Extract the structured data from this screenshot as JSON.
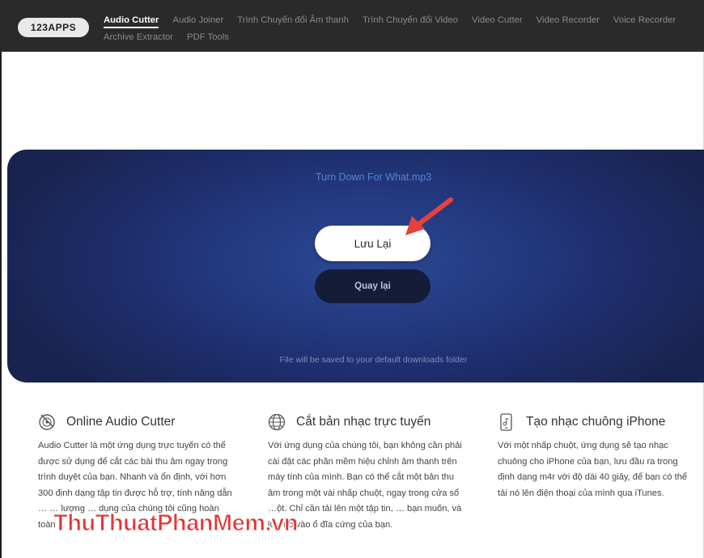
{
  "brand": {
    "logo": "123APPS"
  },
  "nav": {
    "items": [
      {
        "label": "Audio Cutter",
        "active": true
      },
      {
        "label": "Audio Joiner"
      },
      {
        "label": "Trình Chuyển đổi Âm thanh"
      },
      {
        "label": "Trình Chuyển đổi Video"
      },
      {
        "label": "Video Cutter"
      },
      {
        "label": "Video Recorder"
      },
      {
        "label": "Voice Recorder"
      },
      {
        "label": "Archive Extractor"
      },
      {
        "label": "PDF Tools"
      }
    ]
  },
  "editor": {
    "filename": "Turn Down For What.mp3",
    "save_label": "Lưu Lại",
    "back_label": "Quay lại",
    "save_note": "File will be saved to your default downloads folder"
  },
  "features": [
    {
      "icon": "vinyl-scissors-icon",
      "title": "Online Audio Cutter",
      "body": "Audio Cutter là một ứng dụng trực tuyến có thể được sử dụng để cắt các bài thu âm ngay trong trình duyệt của bạn. Nhanh và ổn định, với hơn 300 định dạng tập tin được hỗ trợ, tính năng dẫn … … lượng … dụng của chúng tôi cũng hoàn toàn"
    },
    {
      "icon": "globe-icon",
      "title": "Cắt bản nhạc trực tuyến",
      "body": "Với ứng dụng của chúng tôi, bạn không cần phải cài đặt các phần mềm hiệu chỉnh âm thanh trên máy tính của mình. Bạn có thể cắt một bản thu âm trong một vài nhấp chuột, ngay trong cửa sổ …ột. Chỉ cần tải lên một tập tin, … bạn muốn, và lưu nó vào ổ đĩa cứng của bạn."
    },
    {
      "icon": "phone-music-icon",
      "title": "Tạo nhạc chuông iPhone",
      "body": "Với một nhấp chuột, ứng dụng sẽ tạo nhạc chuông cho iPhone của bạn, lưu đầu ra trong định dạng m4r với độ dài 40 giây, để bạn có thể tải nó lên điện thoại của mình qua iTunes."
    }
  ],
  "watermark": "ThuThuatPhanMem.vn",
  "colors": {
    "topbar": "#2a2a2a",
    "panel": "#1d2c68",
    "filename": "#4f86d6",
    "arrow": "#e8413d",
    "watermark": "#e53434"
  }
}
